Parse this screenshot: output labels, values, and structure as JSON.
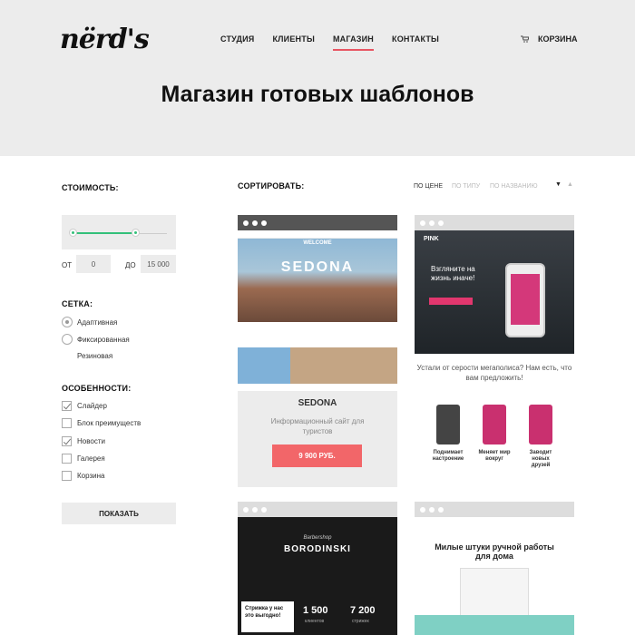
{
  "header": {
    "logo": "nërd's",
    "nav": [
      "СТУДИЯ",
      "КЛИЕНТЫ",
      "МАГАЗИН",
      "КОНТАКТЫ"
    ],
    "active_nav": "МАГАЗИН",
    "cart_label": "КОРЗИНА",
    "accent_color": "#e85562"
  },
  "hero": {
    "title": "Магазин готовых шаблонов"
  },
  "filters": {
    "price_heading": "СТОИМОСТЬ:",
    "from_label": "ОТ",
    "from_value": "0",
    "to_label": "ДО",
    "to_value": "15 000",
    "grid_heading": "СЕТКА:",
    "grid_options": [
      {
        "label": "Адаптивная",
        "selected": true
      },
      {
        "label": "Фиксированная",
        "selected": false
      },
      {
        "label": "Резиновая",
        "selected": false
      }
    ],
    "features_heading": "ОСОБЕННОСТИ:",
    "features": [
      {
        "label": "Слайдер",
        "checked": true
      },
      {
        "label": "Блок преимуществ",
        "checked": false
      },
      {
        "label": "Новости",
        "checked": true
      },
      {
        "label": "Галерея",
        "checked": false
      },
      {
        "label": "Корзина",
        "checked": false
      }
    ],
    "show_button": "ПОКАЗАТЬ"
  },
  "sort": {
    "heading": "СОРТИРОВАТЬ:",
    "options": [
      "ПО ЦЕНЕ",
      "ПО ТИПУ",
      "ПО НАЗВАНИЮ"
    ],
    "active": "ПО ЦЕНЕ"
  },
  "cards": [
    {
      "title": "SEDONA",
      "description": "Информационный сайт для туристов",
      "price": "9 900 РУБ.",
      "preview": {
        "welcome": "WELCOME",
        "name": "SEDONA"
      }
    },
    {
      "preview": {
        "logo": "PINK",
        "headline": "Взгляните на жизнь иначе!",
        "question": "Устали от серости мегаполиса? Нам есть, что вам предложить!",
        "features": [
          "Поднимает настроение",
          "Меняет мир вокруг",
          "Заводит новых друзей"
        ]
      }
    },
    {
      "preview": {
        "subtitle": "Barbershop",
        "name": "BORODINSKI",
        "promo": "Стрижка у нас это выгодно!",
        "stats": [
          {
            "num": "1 500",
            "label": "клиентов"
          },
          {
            "num": "7 200",
            "label": "стрижек"
          }
        ]
      }
    },
    {
      "preview": {
        "headline": "Милые штуки ручной работы для дома"
      }
    }
  ]
}
